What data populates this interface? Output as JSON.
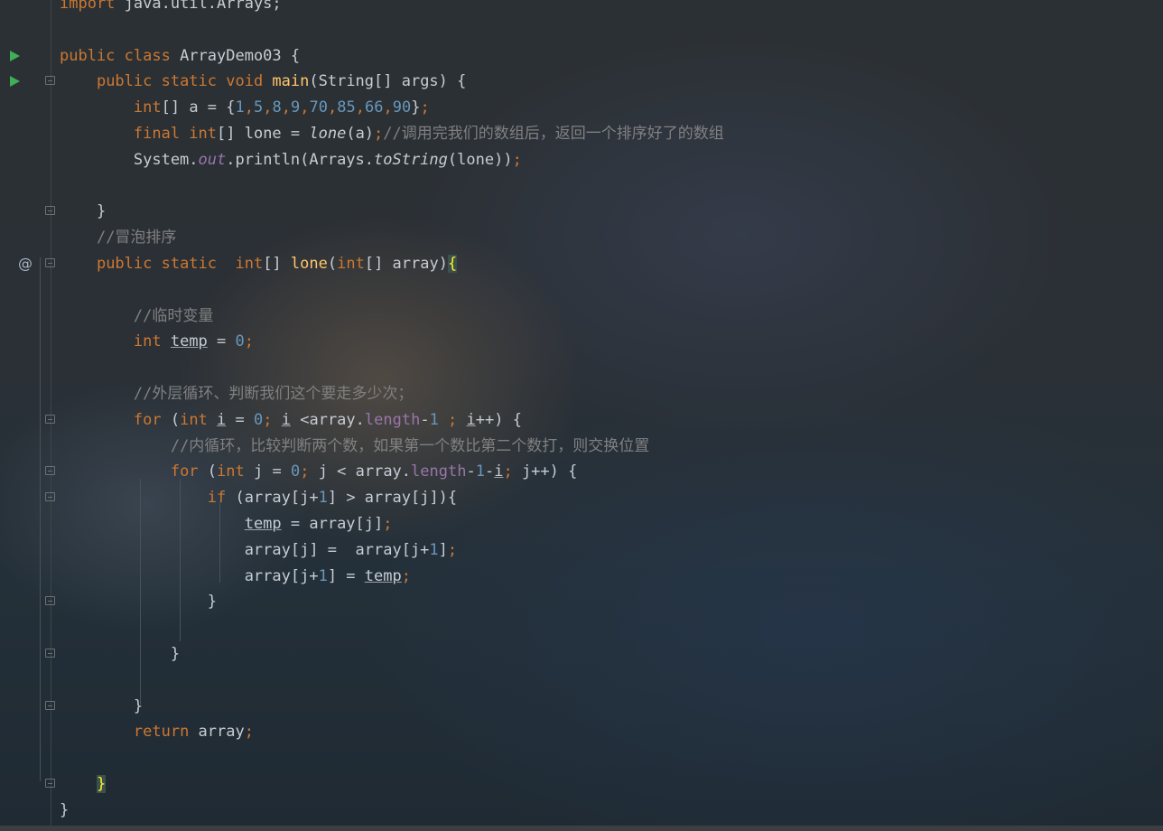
{
  "editor": {
    "file_class": "ArrayDemo03",
    "lines": [
      {
        "n": 1,
        "parts": [
          [
            "kw",
            "import "
          ],
          [
            "",
            "java.util.Arrays;"
          ]
        ],
        "icons": []
      },
      {
        "n": 2,
        "parts": [],
        "icons": []
      },
      {
        "n": 3,
        "parts": [
          [
            "kw",
            "public class "
          ],
          [
            "",
            "ArrayDemo03 {"
          ]
        ],
        "icons": [
          "run"
        ]
      },
      {
        "n": 4,
        "parts": [
          [
            "",
            "    "
          ],
          [
            "kw",
            "public static void "
          ],
          [
            "fn",
            "main"
          ],
          [
            "",
            "(String[] args) {"
          ]
        ],
        "icons": [
          "run",
          "fold"
        ]
      },
      {
        "n": 5,
        "parts": [
          [
            "",
            "        "
          ],
          [
            "kw",
            "int"
          ],
          [
            "",
            "[] a = {"
          ],
          [
            "num",
            "1"
          ],
          [
            "kw",
            ","
          ],
          [
            "num",
            "5"
          ],
          [
            "kw",
            ","
          ],
          [
            "num",
            "8"
          ],
          [
            "kw",
            ","
          ],
          [
            "num",
            "9"
          ],
          [
            "kw",
            ","
          ],
          [
            "num",
            "70"
          ],
          [
            "kw",
            ","
          ],
          [
            "num",
            "85"
          ],
          [
            "kw",
            ","
          ],
          [
            "num",
            "66"
          ],
          [
            "kw",
            ","
          ],
          [
            "num",
            "90"
          ],
          [
            "",
            "}"
          ],
          [
            "kw",
            ";"
          ]
        ],
        "icons": []
      },
      {
        "n": 6,
        "parts": [
          [
            "",
            "        "
          ],
          [
            "kw",
            "final int"
          ],
          [
            "",
            "[] lone = "
          ],
          [
            "it",
            "lone"
          ],
          [
            "",
            "(a)"
          ],
          [
            "kw",
            ";"
          ],
          [
            "cm",
            "//调用完我们的数组后，返回一个排序好了的数组"
          ]
        ],
        "icons": []
      },
      {
        "n": 7,
        "parts": [
          [
            "",
            "        System."
          ],
          [
            "st",
            "out"
          ],
          [
            "",
            ".println(Arrays."
          ],
          [
            "it",
            "toString"
          ],
          [
            "",
            "(lone))"
          ],
          [
            "kw",
            ";"
          ]
        ],
        "icons": []
      },
      {
        "n": 8,
        "parts": [],
        "icons": []
      },
      {
        "n": 9,
        "parts": [
          [
            "",
            "    }"
          ]
        ],
        "icons": [
          "fold"
        ]
      },
      {
        "n": 10,
        "parts": [
          [
            "",
            "    "
          ],
          [
            "cm",
            "//冒泡排序"
          ]
        ],
        "icons": []
      },
      {
        "n": 11,
        "parts": [
          [
            "",
            "    "
          ],
          [
            "kw",
            "public static  int"
          ],
          [
            "",
            "[] "
          ],
          [
            "fn",
            "lone"
          ],
          [
            "",
            "("
          ],
          [
            "kw",
            "int"
          ],
          [
            "",
            "[] array)"
          ],
          [
            "cursor-brace",
            "{"
          ]
        ],
        "icons": [
          "override",
          "fold"
        ]
      },
      {
        "n": 12,
        "parts": [],
        "icons": []
      },
      {
        "n": 13,
        "parts": [
          [
            "",
            "        "
          ],
          [
            "cm",
            "//临时变量"
          ]
        ],
        "icons": []
      },
      {
        "n": 14,
        "parts": [
          [
            "",
            "        "
          ],
          [
            "kw",
            "int "
          ],
          [
            "ul",
            "temp"
          ],
          [
            "",
            " = "
          ],
          [
            "num",
            "0"
          ],
          [
            "kw",
            ";"
          ]
        ],
        "icons": []
      },
      {
        "n": 15,
        "parts": [],
        "icons": []
      },
      {
        "n": 16,
        "parts": [
          [
            "",
            "        "
          ],
          [
            "cm",
            "//外层循环、判断我们这个要走多少次；"
          ]
        ],
        "icons": []
      },
      {
        "n": 17,
        "parts": [
          [
            "",
            "        "
          ],
          [
            "kw",
            "for "
          ],
          [
            "",
            "("
          ],
          [
            "kw",
            "int "
          ],
          [
            "ul",
            "i"
          ],
          [
            "",
            " = "
          ],
          [
            "num",
            "0"
          ],
          [
            "kw",
            "; "
          ],
          [
            "ul",
            "i"
          ],
          [
            "",
            " <array."
          ],
          [
            "fld",
            "length"
          ],
          [
            "",
            "-"
          ],
          [
            "num",
            "1"
          ],
          [
            "kw",
            " ; "
          ],
          [
            "ul",
            "i"
          ],
          [
            "",
            "++) {"
          ]
        ],
        "icons": [
          "fold"
        ]
      },
      {
        "n": 18,
        "parts": [
          [
            "",
            "            "
          ],
          [
            "cm",
            "//内循环，比较判断两个数，如果第一个数比第二个数打，则交换位置"
          ]
        ],
        "icons": []
      },
      {
        "n": 19,
        "parts": [
          [
            "",
            "            "
          ],
          [
            "kw",
            "for "
          ],
          [
            "",
            "("
          ],
          [
            "kw",
            "int "
          ],
          [
            "",
            "j = "
          ],
          [
            "num",
            "0"
          ],
          [
            "kw",
            "; "
          ],
          [
            "",
            "j < array."
          ],
          [
            "fld",
            "length"
          ],
          [
            "",
            "-"
          ],
          [
            "num",
            "1"
          ],
          [
            "",
            "-"
          ],
          [
            "ul",
            "i"
          ],
          [
            "kw",
            "; "
          ],
          [
            "",
            "j++) {"
          ]
        ],
        "icons": [
          "fold"
        ]
      },
      {
        "n": 20,
        "parts": [
          [
            "",
            "                "
          ],
          [
            "kw",
            "if "
          ],
          [
            "",
            "(array[j+"
          ],
          [
            "num",
            "1"
          ],
          [
            "",
            "] > array[j]){"
          ]
        ],
        "icons": [
          "fold"
        ]
      },
      {
        "n": 21,
        "parts": [
          [
            "",
            "                    "
          ],
          [
            "ul",
            "temp"
          ],
          [
            "",
            " = array[j]"
          ],
          [
            "kw",
            ";"
          ]
        ],
        "icons": []
      },
      {
        "n": 22,
        "parts": [
          [
            "",
            "                    array[j] =  array[j+"
          ],
          [
            "num",
            "1"
          ],
          [
            "",
            "]"
          ],
          [
            "kw",
            ";"
          ]
        ],
        "icons": []
      },
      {
        "n": 23,
        "parts": [
          [
            "",
            "                    array[j+"
          ],
          [
            "num",
            "1"
          ],
          [
            "",
            "] = "
          ],
          [
            "ul",
            "temp"
          ],
          [
            "kw",
            ";"
          ]
        ],
        "icons": []
      },
      {
        "n": 24,
        "parts": [
          [
            "",
            "                }"
          ]
        ],
        "icons": [
          "fold"
        ]
      },
      {
        "n": 25,
        "parts": [],
        "icons": []
      },
      {
        "n": 26,
        "parts": [
          [
            "",
            "            }"
          ]
        ],
        "icons": [
          "fold"
        ]
      },
      {
        "n": 27,
        "parts": [],
        "icons": []
      },
      {
        "n": 28,
        "parts": [
          [
            "",
            "        }"
          ]
        ],
        "icons": [
          "fold"
        ]
      },
      {
        "n": 29,
        "parts": [
          [
            "",
            "        "
          ],
          [
            "kw",
            "return "
          ],
          [
            "",
            "array"
          ],
          [
            "kw",
            ";"
          ]
        ],
        "icons": []
      },
      {
        "n": 30,
        "parts": [],
        "icons": []
      },
      {
        "n": 31,
        "parts": [
          [
            "",
            "    "
          ],
          [
            "cursor-brace",
            "}"
          ]
        ],
        "icons": [
          "fold"
        ]
      },
      {
        "n": 32,
        "parts": [
          [
            "",
            "}"
          ]
        ],
        "icons": []
      }
    ]
  },
  "colors": {
    "keyword": "#cc7832",
    "number": "#6897bb",
    "comment": "#808080",
    "method": "#ffc66d",
    "field": "#9876aa",
    "text": "#c5ccd3",
    "run_icon": "#3fae55"
  },
  "icon_names": {
    "run": "run-gutter-icon",
    "fold": "fold-icon",
    "override": "override-icon"
  }
}
